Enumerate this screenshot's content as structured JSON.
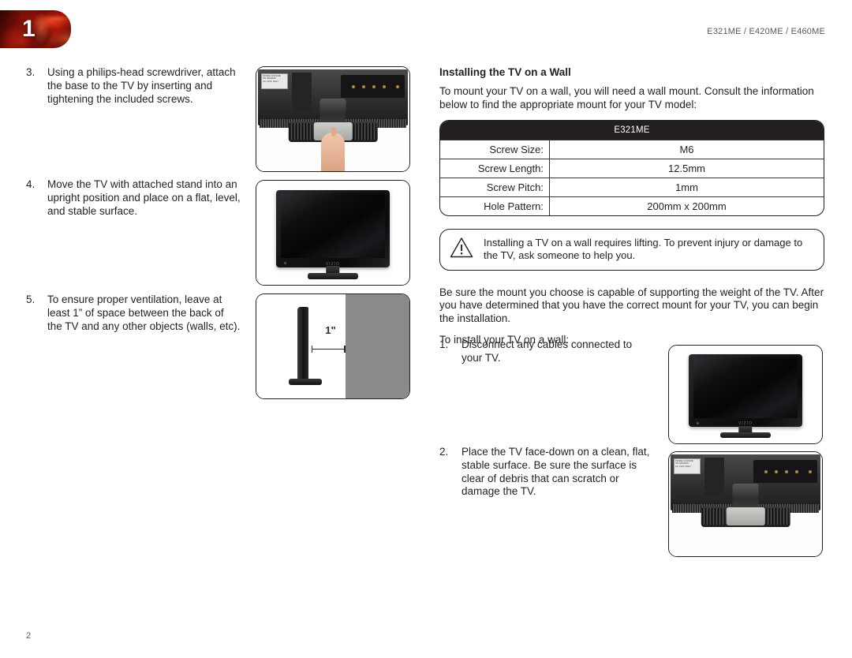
{
  "page": {
    "chapter_badge_number": "1",
    "model_header": "E321ME / E420ME / E460ME",
    "page_number": "2",
    "accent_color": "#8c1509",
    "header_text_color": "#58595b",
    "body_text_color": "#231f20"
  },
  "left_column": {
    "steps": [
      {
        "marker": "3.",
        "text": "Using a philips-head screwdriver, attach the base to the TV by inserting and tightening the included screws."
      },
      {
        "marker": "4.",
        "text": "Move the TV with attached stand into an upright position and place on a flat, level, and stable surface."
      },
      {
        "marker": "5.",
        "text": "To ensure proper ventilation, leave at least 1” of space between the back of the TV and any other objects (walls, etc)."
      }
    ],
    "figures": [
      {
        "name": "tv-back-with-hand-attaching-base",
        "caption": ""
      },
      {
        "name": "tv-front-on-stand",
        "caption": ""
      },
      {
        "name": "tv-side-view-wall-clearance",
        "dimension_label": "1\""
      }
    ]
  },
  "right_column": {
    "section_title": "Installing the TV on a Wall",
    "intro_paragraph": "To mount your TV on a wall, you will need a wall mount. Consult the information below to find the appropriate mount for your TV model:",
    "spec_table": {
      "header": "E321ME",
      "rows": [
        {
          "label": "Screw Size:",
          "value": "M6"
        },
        {
          "label": "Screw Length:",
          "value": "12.5mm"
        },
        {
          "label": "Screw Pitch:",
          "value": "1mm"
        },
        {
          "label": "Hole Pattern:",
          "value": "200mm x 200mm"
        }
      ]
    },
    "warning": {
      "icon": "warning-triangle-icon",
      "text": "Installing a TV on a wall requires lifting. To prevent injury or damage to the TV, ask someone to help you."
    },
    "paragraph_mount_capable": "Be sure the mount you choose is capable of supporting the weight of the TV. After you have determined that you have the correct mount for your TV, you can begin the installation.",
    "paragraph_to_install": "To install your TV on a wall:",
    "steps": [
      {
        "marker": "1.",
        "text": "Disconnect any cables connected to your TV."
      },
      {
        "marker": "2.",
        "text": "Place the TV face-down on a clean, flat, stable surface. Be sure the surface is clear of debris that can scratch or damage the TV."
      }
    ],
    "figures": [
      {
        "name": "tv-front-on-stand",
        "caption": ""
      },
      {
        "name": "tv-back-face-down",
        "caption": ""
      }
    ]
  },
  "tv_brand_logo": "VIZIO"
}
